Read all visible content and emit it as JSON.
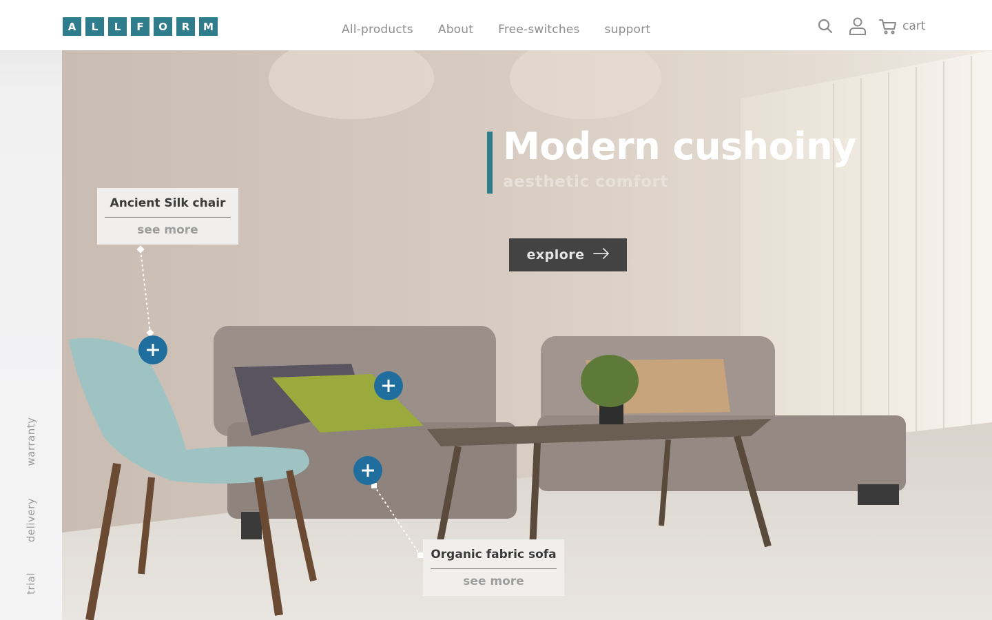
{
  "header": {
    "logo_letters": [
      "A",
      "L",
      "L",
      "F",
      "O",
      "R",
      "M"
    ],
    "nav": [
      "All-products",
      "About",
      "Free-switches",
      "support"
    ],
    "cart_label": "cart",
    "icons": [
      "search-icon",
      "user-icon",
      "cart-icon"
    ]
  },
  "sidebar": {
    "links": [
      "warranty",
      "delivery",
      "trial"
    ]
  },
  "hero": {
    "headline": "Modern cushoiny",
    "subhead": "aesthetic comfort",
    "explore_label": "explore",
    "hotspots": [
      {
        "title": "Ancient Silk chair",
        "link": "see more"
      },
      {
        "title": "Organic fabric sofa",
        "link": "see more"
      }
    ]
  },
  "colors": {
    "accent": "#2f7d8c",
    "hotspot": "#1f6e9e",
    "button_bg": "#444343"
  }
}
